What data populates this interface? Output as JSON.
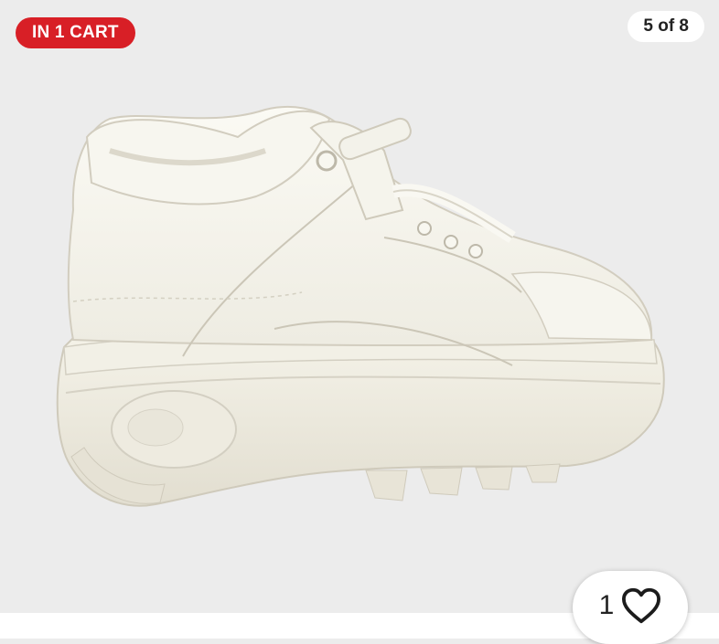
{
  "badge": {
    "label": "IN 1 CART",
    "color": "#d81f26"
  },
  "gallery": {
    "counter": "5 of 8"
  },
  "likes": {
    "count": "1",
    "icon": "heart-outline-icon"
  },
  "image": {
    "subject": "white-platform-sneaker-photo"
  }
}
